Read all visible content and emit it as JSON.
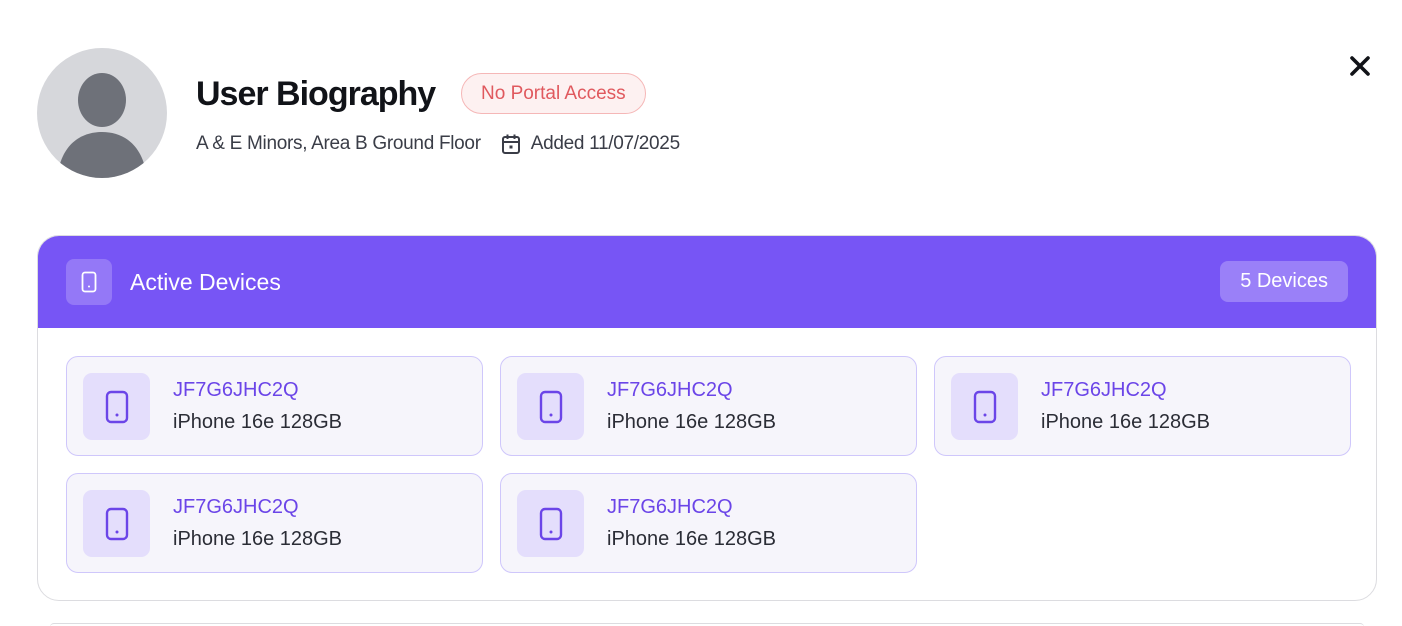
{
  "profile": {
    "title": "User Biography",
    "badge": "No Portal Access",
    "location": "A & E Minors, Area B Ground Floor",
    "added": "Added 11/07/2025",
    "avatar_icon": "user-silhouette-icon",
    "calendar_icon": "calendar-icon"
  },
  "close_icon": "close-icon",
  "devices_panel": {
    "title": "Active Devices",
    "count": "5 Devices",
    "header_icon": "phone-icon",
    "header_color": "#7755f5",
    "devices": [
      {
        "serial": "JF7G6JHC2Q",
        "model": "iPhone 16e 128GB"
      },
      {
        "serial": "JF7G6JHC2Q",
        "model": "iPhone 16e 128GB"
      },
      {
        "serial": "JF7G6JHC2Q",
        "model": "iPhone 16e 128GB"
      },
      {
        "serial": "JF7G6JHC2Q",
        "model": "iPhone 16e 128GB"
      },
      {
        "serial": "JF7G6JHC2Q",
        "model": "iPhone 16e 128GB"
      }
    ]
  },
  "colors": {
    "accent": "#7755f5",
    "badge_text": "#e0595e",
    "serial_text": "#6b45e8"
  }
}
